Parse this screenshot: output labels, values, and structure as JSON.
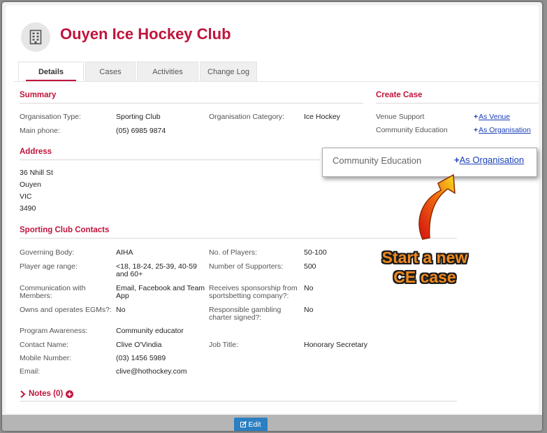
{
  "header": {
    "title": "Ouyen Ice Hockey Club",
    "icon": "building-icon"
  },
  "tabs": [
    {
      "label": "Details",
      "active": true
    },
    {
      "label": "Cases",
      "active": false
    },
    {
      "label": "Activities",
      "active": false
    },
    {
      "label": "Change Log",
      "active": false
    }
  ],
  "summary": {
    "heading": "Summary",
    "org_type_label": "Organisation Type:",
    "org_type_value": "Sporting Club",
    "org_category_label": "Organisation Category:",
    "org_category_value": "Ice Hockey",
    "phone_label": "Main phone:",
    "phone_value": "(05) 6985 9874"
  },
  "create_case": {
    "heading": "Create Case",
    "venue_support_label": "Venue Support",
    "venue_link": "As Venue",
    "community_education_label": "Community Education",
    "organisation_link": "As Organisation"
  },
  "address": {
    "heading": "Address",
    "lines": [
      "36 Nhill St",
      "Ouyen",
      "VIC",
      "3490"
    ]
  },
  "callout": {
    "label": "Community Education",
    "link": "As Organisation"
  },
  "annotation": {
    "line1": "Start a new",
    "line2": "CE case"
  },
  "contacts": {
    "heading": "Sporting Club Contacts",
    "governing_body_label": "Governing Body:",
    "governing_body_value": "AIHA",
    "players_label": "No. of Players:",
    "players_value": "50-100",
    "age_range_label": "Player age range:",
    "age_range_value_1": "<18, 18-24, 25-39, 40-59",
    "age_range_value_2": "and 60+",
    "supporters_label": "Number of Supporters:",
    "supporters_value": "500",
    "communication_label_1": "Communication with",
    "communication_label_2": "Members:",
    "communication_value_1": "Email, Facebook and Team",
    "communication_value_2": "App",
    "sponsorship_label_1": "Receives sponsorship from",
    "sponsorship_label_2": "sportsbetting company?:",
    "sponsorship_value": "No",
    "egm_label": "Owns and operates EGMs?:",
    "egm_value": "No",
    "charter_label_1": "Responsible gambling",
    "charter_label_2": "charter signed?:",
    "charter_value": "No",
    "program_label": "Program Awareness:",
    "program_value": "Community educator",
    "contact_name_label": "Contact Name:",
    "contact_name_value": "Clive O'Vindia",
    "job_title_label": "Job Title:",
    "job_title_value": "Honorary Secretary",
    "mobile_label": "Mobile Number:",
    "mobile_value": "(03) 1456 5989",
    "email_label": "Email:",
    "email_value": "clive@hothockey.com"
  },
  "notes": {
    "label": "Notes (0)"
  },
  "footer": {
    "edit_label": "Edit"
  },
  "colors": {
    "accent": "#c0143c",
    "link": "#1a3fb5",
    "button": "#2b7fc2",
    "annotation": "#f08a1c"
  }
}
